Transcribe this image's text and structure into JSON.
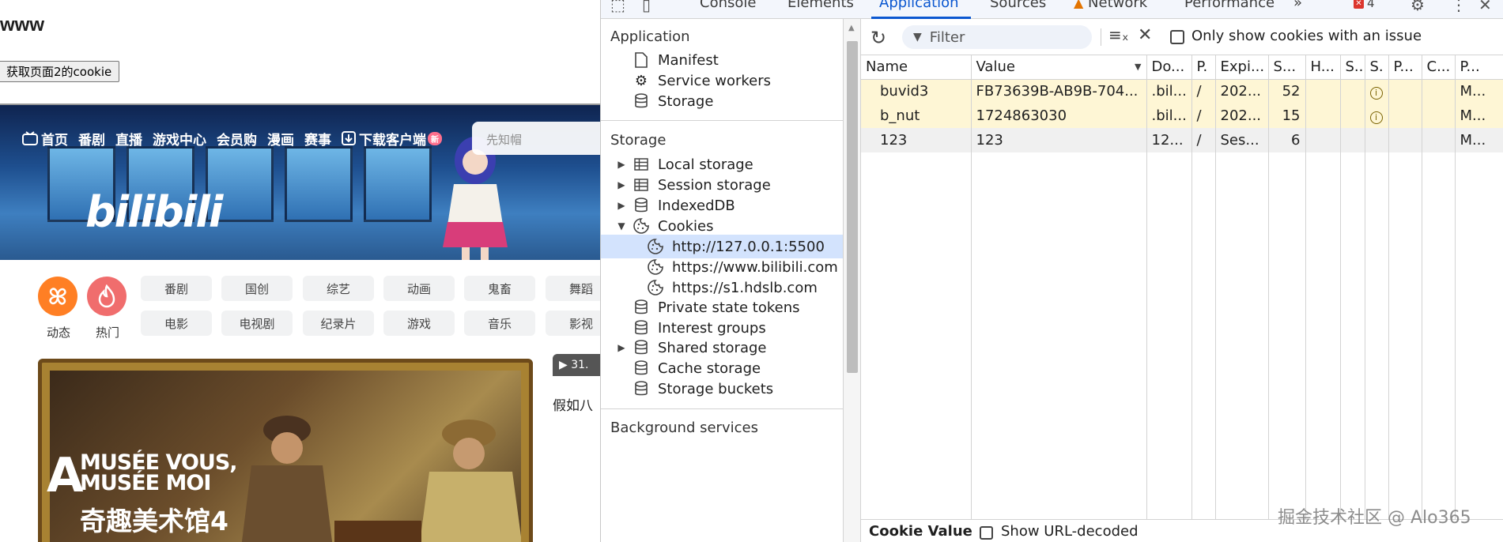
{
  "page": {
    "heading": "www",
    "get_cookie_button": "获取页面2的cookie",
    "embedded": {
      "nav_items": [
        "首页",
        "番剧",
        "直播",
        "游戏中心",
        "会员购",
        "漫画",
        "赛事",
        "下载客户端"
      ],
      "new_badge": "新",
      "search_placeholder": "先知帽",
      "logo": "bilibili",
      "quick_links": [
        "动态",
        "热门"
      ],
      "categories_row1": [
        "番剧",
        "国创",
        "综艺",
        "动画",
        "鬼畜",
        "舞蹈"
      ],
      "categories_row2": [
        "电影",
        "电视剧",
        "纪录片",
        "游戏",
        "音乐",
        "影视"
      ],
      "video_title_line1": "MUSÉE VOUS,",
      "video_title_line2": "MUSÉE MOI",
      "video_big_letter": "A",
      "video_title_cn": "奇趣美术馆4",
      "side_badge": "31.",
      "side_title": "假如八"
    }
  },
  "devtools": {
    "tabs": [
      "Console",
      "Elements",
      "Application",
      "Sources",
      "Network",
      "Performance"
    ],
    "active_tab": "Application",
    "error_count": "4",
    "sidebar": {
      "application_title": "Application",
      "application_items": [
        "Manifest",
        "Service workers",
        "Storage"
      ],
      "storage_title": "Storage",
      "storage_items": [
        "Local storage",
        "Session storage",
        "IndexedDB",
        "Cookies"
      ],
      "cookie_origins": [
        "http://127.0.0.1:5500",
        "https://www.bilibili.com",
        "https://s1.hdslb.com"
      ],
      "storage_items_2": [
        "Private state tokens",
        "Interest groups",
        "Shared storage",
        "Cache storage",
        "Storage buckets"
      ],
      "background_title": "Background services"
    },
    "toolbar": {
      "filter_placeholder": "Filter",
      "issue_label": "Only show cookies with an issue"
    },
    "table": {
      "headers": [
        "Name",
        "Value",
        "Do...",
        "P.",
        "Expi...",
        "S...",
        "H...",
        "S...",
        "S.",
        "P...",
        "C...",
        "P..."
      ],
      "rows": [
        {
          "name": "buvid3",
          "value": "FB73639B-AB9B-704...",
          "domain": ".bil...",
          "path": "/",
          "expires": "202...",
          "size": "52",
          "c12": "M..."
        },
        {
          "name": "b_nut",
          "value": "1724863030",
          "domain": ".bil...",
          "path": "/",
          "expires": "202...",
          "size": "15",
          "c12": "M..."
        },
        {
          "name": "123",
          "value": "123",
          "domain": "12...",
          "path": "/",
          "expires": "Ses...",
          "size": "6",
          "c12": "M..."
        }
      ]
    },
    "bottom": {
      "cookie_value_label": "Cookie Value",
      "decode_label": "Show URL-decoded"
    }
  },
  "watermark": "掘金技术社区 @ Alo365"
}
